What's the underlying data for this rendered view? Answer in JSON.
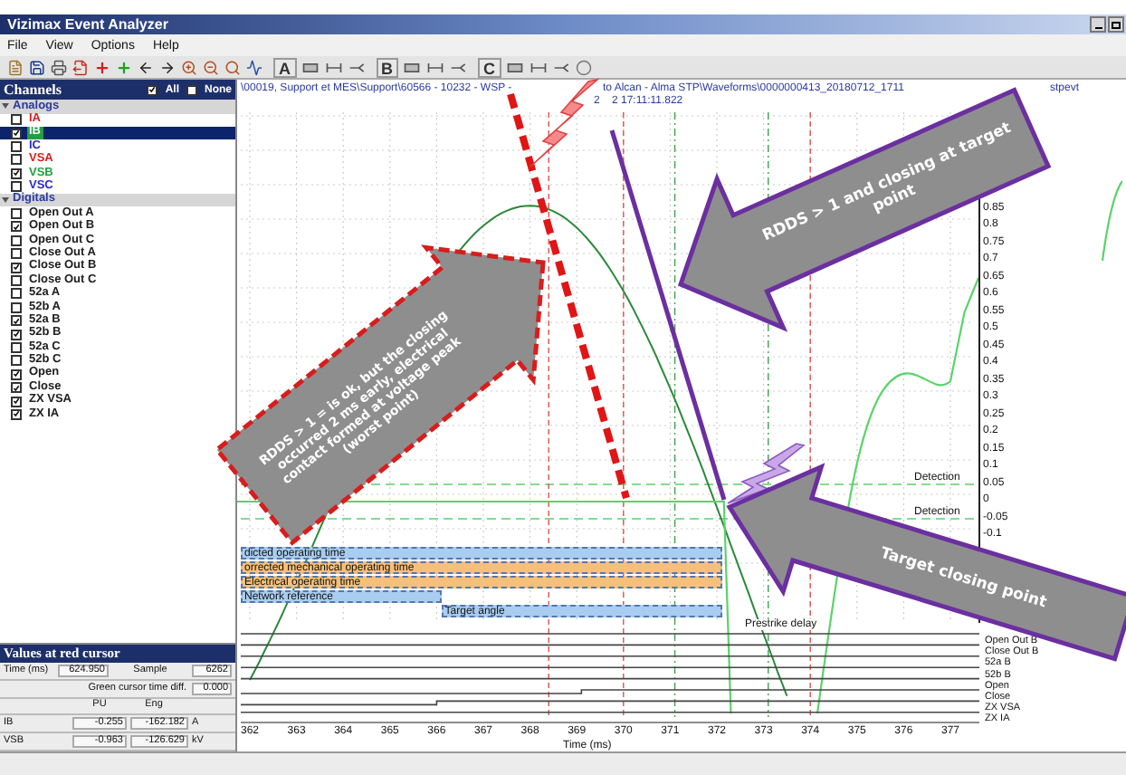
{
  "window": {
    "title": "Vizimax Event Analyzer"
  },
  "menu": [
    "File",
    "View",
    "Options",
    "Help"
  ],
  "toolbar_letters": [
    "A",
    "B",
    "C"
  ],
  "channels": {
    "title": "Channels",
    "all": {
      "label": "All",
      "checked": true
    },
    "none": {
      "label": "None",
      "checked": false
    },
    "groups": [
      {
        "label": "Analogs",
        "expanded": true,
        "items": [
          {
            "label": "IA",
            "checked": false,
            "selected": false,
            "color": "#d42020"
          },
          {
            "label": "IB",
            "checked": true,
            "selected": true,
            "color": "#22a040"
          },
          {
            "label": "IC",
            "checked": false,
            "selected": false,
            "color": "#2a2ad0"
          },
          {
            "label": "VSA",
            "checked": false,
            "selected": false,
            "color": "#d42020"
          },
          {
            "label": "VSB",
            "checked": true,
            "selected": false,
            "color": "#22a040"
          },
          {
            "label": "VSC",
            "checked": false,
            "selected": false,
            "color": "#2a2ad0"
          }
        ]
      },
      {
        "label": "Digitals",
        "expanded": true,
        "items": [
          {
            "label": "Open Out A",
            "checked": false,
            "selected": false,
            "color": "#202020"
          },
          {
            "label": "Open Out B",
            "checked": true,
            "selected": false,
            "color": "#202020"
          },
          {
            "label": "Open Out C",
            "checked": false,
            "selected": false,
            "color": "#202020"
          },
          {
            "label": "Close Out A",
            "checked": false,
            "selected": false,
            "color": "#202020"
          },
          {
            "label": "Close Out B",
            "checked": true,
            "selected": false,
            "color": "#202020"
          },
          {
            "label": "Close Out C",
            "checked": false,
            "selected": false,
            "color": "#202020"
          },
          {
            "label": "52a A",
            "checked": false,
            "selected": false,
            "color": "#202020"
          },
          {
            "label": "52b A",
            "checked": false,
            "selected": false,
            "color": "#202020"
          },
          {
            "label": "52a B",
            "checked": true,
            "selected": false,
            "color": "#202020"
          },
          {
            "label": "52b B",
            "checked": true,
            "selected": false,
            "color": "#202020"
          },
          {
            "label": "52a C",
            "checked": false,
            "selected": false,
            "color": "#202020"
          },
          {
            "label": "52b C",
            "checked": false,
            "selected": false,
            "color": "#202020"
          },
          {
            "label": "Open",
            "checked": true,
            "selected": false,
            "color": "#202020"
          },
          {
            "label": "Close",
            "checked": true,
            "selected": false,
            "color": "#202020"
          },
          {
            "label": "ZX VSA",
            "checked": true,
            "selected": false,
            "color": "#202020"
          },
          {
            "label": "ZX IA",
            "checked": true,
            "selected": false,
            "color": "#202020"
          }
        ]
      }
    ]
  },
  "values_panel": {
    "title": "Values at red cursor",
    "time_label": "Time (ms)",
    "time": "624.950",
    "sample_label": "Sample",
    "sample": "6262",
    "diff_label": "Green cursor time diff.",
    "diff": "0.000",
    "col_pu": "PU",
    "col_eng": "Eng",
    "rows": [
      {
        "name": "IB",
        "pu": "-0.255",
        "eng": "-162.182",
        "unit": "A"
      },
      {
        "name": "VSB",
        "pu": "-0.963",
        "eng": "-126.629",
        "unit": "kV"
      }
    ]
  },
  "plot": {
    "path_line1": [
      "\\00019, Support et MES\\Support\\60566 - 10232 - WSP -",
      "to Alcan - Alma STP\\Waveforms\\0000000413_20180712_1711",
      "stpevt"
    ],
    "path_line2": [
      "2",
      "2 17:11:11.822"
    ],
    "yticks": [
      "0.85",
      "0.8",
      "0.75",
      "0.7",
      "0.65",
      "0.6",
      "0.55",
      "0.5",
      "0.45",
      "0.4",
      "0.35",
      "0.3",
      "0.25",
      "0.2",
      "0.15",
      "0.1",
      "0.05",
      "0",
      "-0.05",
      "-0.1"
    ],
    "xticks": [
      "362",
      "363",
      "364",
      "365",
      "366",
      "367",
      "368",
      "369",
      "370",
      "371",
      "372",
      "373",
      "374",
      "375",
      "376",
      "377"
    ],
    "xlabel": "Time (ms)",
    "detection_labels": [
      "Detection",
      "Detection"
    ],
    "bars": [
      {
        "label": "dicted operating time",
        "kind": "blue"
      },
      {
        "label": "orrected mechanical operating time",
        "kind": "orange"
      },
      {
        "label": "Electrical operating time",
        "kind": "orange"
      },
      {
        "label": "Network reference",
        "kind": "blue"
      },
      {
        "label": "Target angle",
        "kind": "blue"
      }
    ],
    "prestrike_label": "Prestrike delay",
    "digital_labels": [
      "Open Out B",
      "Close Out B",
      "52a B",
      "52b B",
      "Open",
      "Close",
      "ZX VSA",
      "ZX IA"
    ]
  },
  "callouts": [
    {
      "text": "RDDS > 1 = is ok, but the closing occurred 2 ms early, electrical contact formed at voltage peak (worst point)",
      "kind": "red"
    },
    {
      "text": "RDDS > 1 and closing at target point",
      "kind": "purple"
    },
    {
      "text": "Target closing point",
      "kind": "purple"
    }
  ]
}
